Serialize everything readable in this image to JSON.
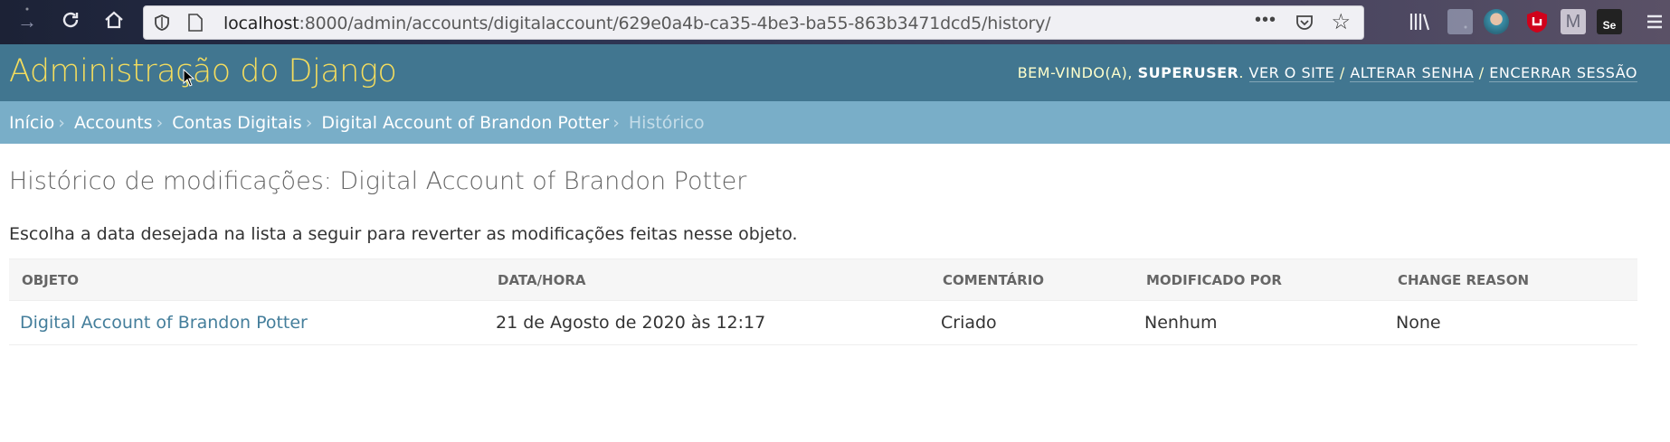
{
  "browser": {
    "url_host": "localhost",
    "url_rest": ":8000/admin/accounts/digitalaccount/629e0a4b-ca35-4be3-ba55-863b3471dcd5/history/",
    "more_label": "•••",
    "extension_badge": "Se"
  },
  "header": {
    "site_name": "Administração do Django",
    "welcome": "Bem-vindo(a),",
    "username": "superuser",
    "view_site": "Ver o site",
    "change_password": "Alterar senha",
    "logout": "Encerrar sessão"
  },
  "breadcrumbs": {
    "home": "Início",
    "app": "Accounts",
    "model": "Contas Digitais",
    "object": "Digital Account of Brandon Potter",
    "current": "Histórico"
  },
  "content": {
    "title": "Histórico de modificações: Digital Account of Brandon Potter",
    "help_text": "Escolha a data desejada na lista a seguir para reverter as modificações feitas nesse objeto."
  },
  "table": {
    "headers": [
      "Objeto",
      "Data/hora",
      "Comentário",
      "Modificado por",
      "Change reason"
    ],
    "rows": [
      {
        "object": "Digital Account of Brandon Potter",
        "datetime": "21 de Agosto de 2020 às 12:17",
        "comment": "Criado",
        "modified_by": "Nenhum",
        "change_reason": "None"
      }
    ]
  },
  "colors": {
    "header_bg": "#417690",
    "branding": "#f5dd5d",
    "breadcrumbs_bg": "#79aec8",
    "link": "#447e9b"
  }
}
